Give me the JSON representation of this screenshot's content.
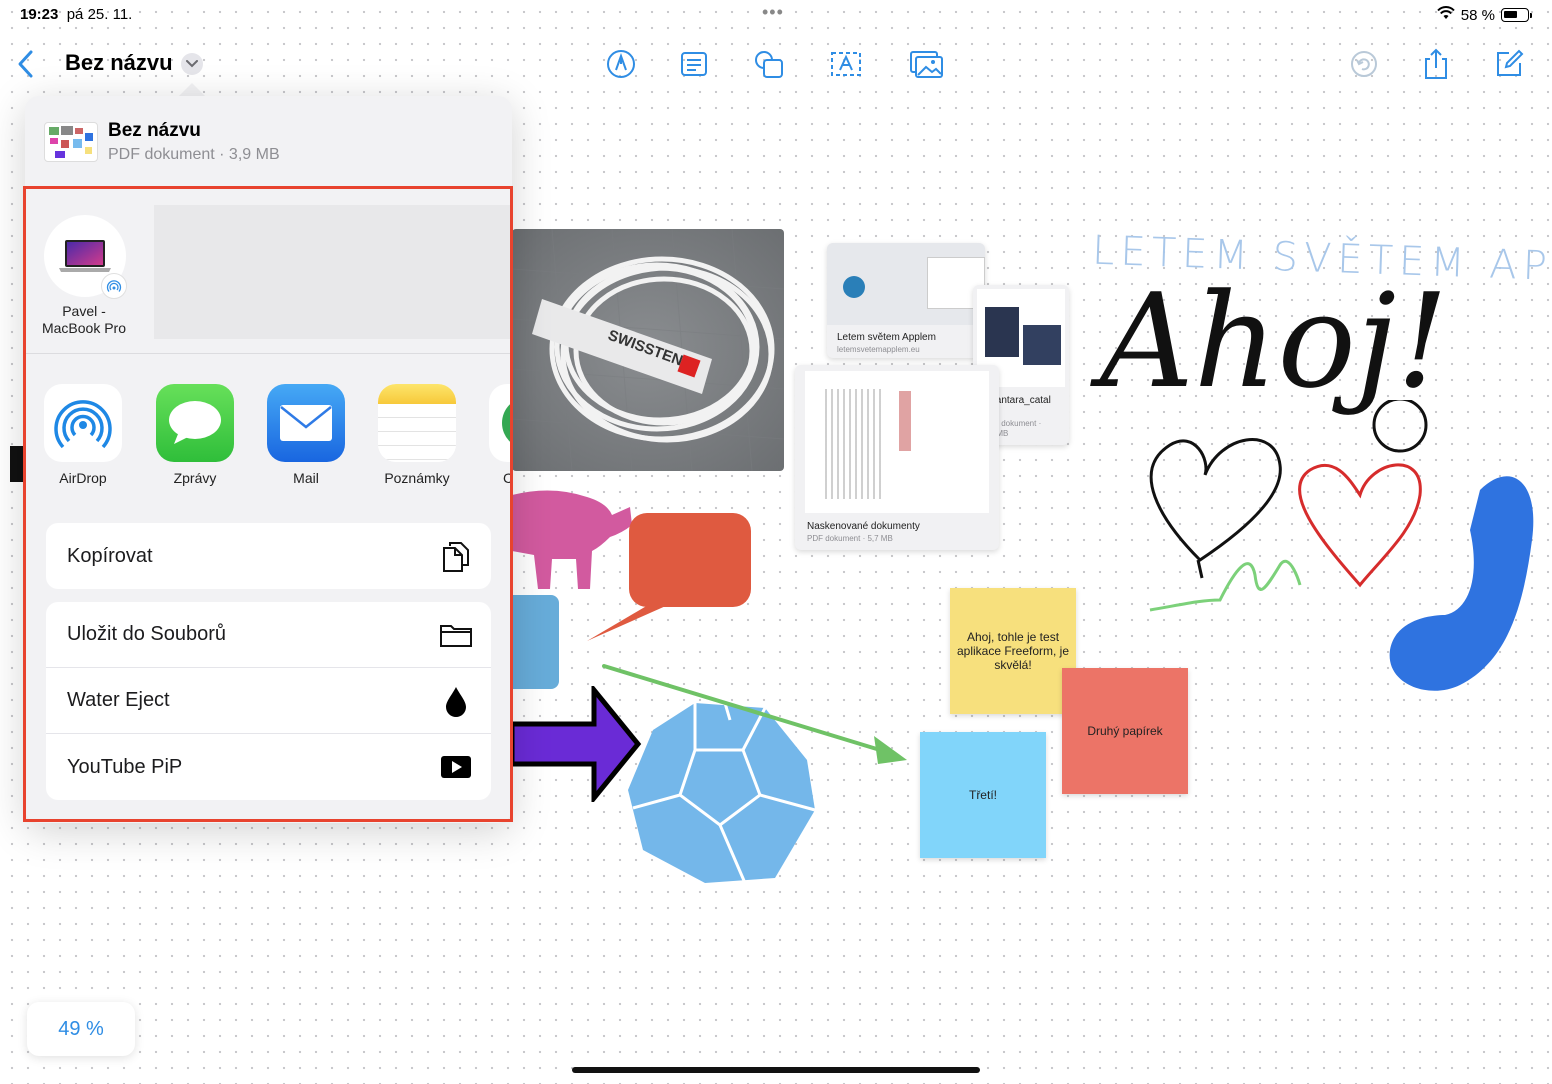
{
  "status": {
    "time": "19:23",
    "date": "pá 25. 11.",
    "battery": "58 %"
  },
  "toolbar": {
    "title": "Bez názvu"
  },
  "sheet": {
    "doc_name": "Bez názvu",
    "doc_meta": "PDF dokument · 3,9 MB",
    "device_name": "Pavel -\nMacBook Pro",
    "apps": [
      {
        "label": "AirDrop",
        "icon": "airdrop-icon"
      },
      {
        "label": "Zprávy",
        "icon": "messages-icon"
      },
      {
        "label": "Mail",
        "icon": "mail-icon"
      },
      {
        "label": "Poznámky",
        "icon": "notes-icon"
      },
      {
        "label": "C",
        "icon": "chrome-icon"
      }
    ],
    "actions_primary": [
      {
        "label": "Kopírovat",
        "icon": "copy-icon"
      }
    ],
    "actions_secondary": [
      {
        "label": "Uložit do Souborů",
        "icon": "folder-icon"
      },
      {
        "label": "Water Eject",
        "icon": "water-drop-icon"
      },
      {
        "label": "YouTube PiP",
        "icon": "play-icon"
      }
    ]
  },
  "canvas": {
    "zoom": "49 %",
    "card_1": {
      "title": "Letem světem Applem",
      "meta": "letemsvetemapplem.eu"
    },
    "card_2": {
      "title": "alcantara_catal\nog",
      "meta": "PDF dokument ·\n3,5 MB"
    },
    "card_3": {
      "title": "Naskenované dokumenty",
      "meta": "PDF dokument · 5,7 MB"
    },
    "sticky_1": "Ahoj, tohle je test aplikace Freeform, je skvělá!",
    "sticky_2": "Druhý papírek",
    "sticky_3": "Třetí!",
    "handwriting_top": "LETEM SVĚTEM APPLEM",
    "handwriting_main": "Ahoj!"
  }
}
